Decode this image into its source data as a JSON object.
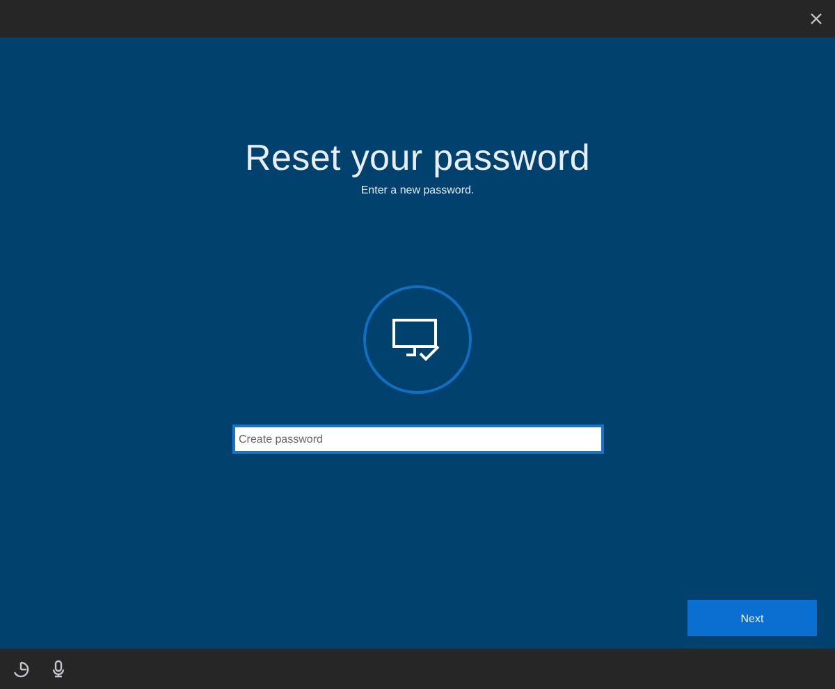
{
  "title": "Reset your password",
  "subtitle": "Enter a new password.",
  "password_field": {
    "placeholder": "Create password"
  },
  "buttons": [
    {
      "label": "Next"
    }
  ]
}
